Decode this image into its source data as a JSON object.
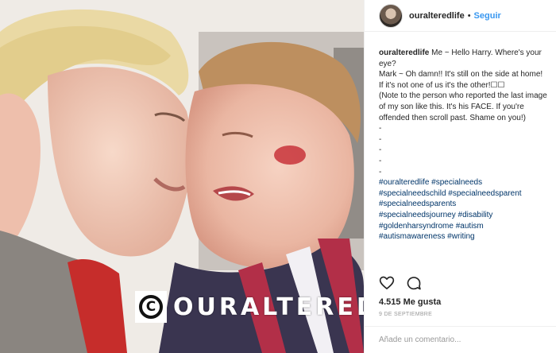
{
  "post": {
    "username": "ouralteredlife",
    "follow_label": "Seguir",
    "separator": "•",
    "caption_lines": [
      "Me ~ Hello Harry. Where's your eye?",
      "Mark ~ Oh damn!! It's still on the side at home!",
      "If it's not one of us it's the other!☐☐",
      "(Note to the person who reported the last image of my son like this. It's his FACE. If you're offended then scroll past. Shame on you!)",
      "-",
      "-",
      "-",
      "-",
      "-"
    ],
    "hashtags": [
      "#ouralteredlife",
      "#specialneeds",
      "#specialneedschild",
      "#specialneedsparent",
      "#specialneedsparents",
      "#specialneedsjourney",
      "#disability",
      "#goldenharsyndrome",
      "#autism",
      "#autismawareness",
      "#writing"
    ],
    "likes": "4.515 Me gusta",
    "date": "9 DE SEPTIEMBRE",
    "comment_placeholder": "Añade un comentario..."
  },
  "photo": {
    "watermark_text": "OURALTEREDLIFE",
    "watermark_symbol": "C"
  },
  "colors": {
    "link": "#3897f0",
    "hashtag": "#003569",
    "muted": "#999999"
  },
  "icons": [
    "heart-icon",
    "comment-icon",
    "copyright-logo-icon"
  ]
}
